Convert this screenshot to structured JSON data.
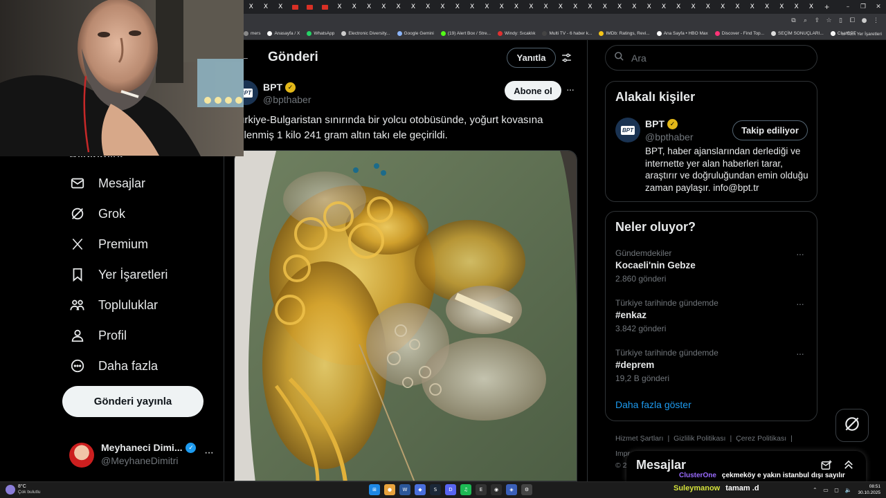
{
  "browser": {
    "tab_glyph": "X",
    "tab_plus": "+",
    "window_controls": [
      "–",
      "❐",
      "✕"
    ],
    "bookmarks": [
      {
        "label": "mers",
        "color": "#888888"
      },
      {
        "label": "Anasayfa / X",
        "color": "#ffffff"
      },
      {
        "label": "WhatsApp",
        "color": "#25d366"
      },
      {
        "label": "Electronic Diversity...",
        "color": "#cccccc"
      },
      {
        "label": "Google Gemini",
        "color": "#8ab4f8"
      },
      {
        "label": "(19) Alert Box / Stre...",
        "color": "#53fc18"
      },
      {
        "label": "Windy: Sıcaklık",
        "color": "#e03030"
      },
      {
        "label": "Multi TV - 6 haber k...",
        "color": "#444444"
      },
      {
        "label": "IMDb: Ratings, Revi...",
        "color": "#f5c518"
      },
      {
        "label": "Ana Sayfa • HBO Max",
        "color": "#ffffff"
      },
      {
        "label": "Discover - Find Top...",
        "color": "#ff3377"
      },
      {
        "label": "SEÇİM SONUÇLARI...",
        "color": "#dddddd"
      },
      {
        "label": "ChatGPT",
        "color": "#ffffff"
      }
    ],
    "bookmarks_overflow": "»",
    "all_bookmarks": "Tüm Yer İşaretleri"
  },
  "nav": {
    "partial_item": "Bildirimler",
    "items": [
      {
        "label": "Mesajlar",
        "icon": "envelope-icon"
      },
      {
        "label": "Grok",
        "icon": "grok-icon"
      },
      {
        "label": "Premium",
        "icon": "x-logo-icon"
      },
      {
        "label": "Yer İşaretleri",
        "icon": "bookmark-icon"
      },
      {
        "label": "Topluluklar",
        "icon": "communities-icon"
      },
      {
        "label": "Profil",
        "icon": "person-icon"
      },
      {
        "label": "Daha fazla",
        "icon": "more-circle-icon"
      }
    ],
    "post_button": "Gönderi yayınla"
  },
  "account": {
    "name": "Meyhaneci Dimi...",
    "handle": "@MeyhaneDimitri",
    "more": "···",
    "verified_color": "#1d9bf0"
  },
  "main": {
    "back": "←",
    "title": "Gönderi",
    "reply_button": "Yanıtla",
    "tweet": {
      "name": "BPT",
      "handle": "@bpthaber",
      "avatar_text": "BPT",
      "subscribe_button": "Abone ol",
      "more": "···",
      "text_line1": "ürkiye-Bulgaristan sınırında bir yolcu otobüsünde, yoğurt kovasına",
      "text_line2": "zlenmiş 1 kilo 241 gram altın takı ele geçirildi.",
      "photo": "gold-jewelry-photo"
    }
  },
  "right": {
    "search_placeholder": "Ara",
    "related": {
      "title": "Alakalı kişiler",
      "name": "BPT",
      "handle": "@bpthaber",
      "avatar_text": "BPT",
      "follow_button": "Takip ediliyor",
      "bio": "BPT, haber ajanslarından derlediği ve internette yer alan haberleri tarar, araştırır ve doğruluğundan emin olduğu zaman paylaşır. info@bpt.tr"
    },
    "trends": {
      "title": "Neler oluyor?",
      "more": "···",
      "items": [
        {
          "context": "Gündemdekiler",
          "name": "Kocaeli'nin Gebze",
          "count": "2.860 gönderi"
        },
        {
          "context": "Türkiye tarihinde gündemde",
          "name": "#enkaz",
          "count": "3.842 gönderi"
        },
        {
          "context": "Türkiye tarihinde gündemde",
          "name": "#deprem",
          "count": "19,2 B gönderi"
        }
      ],
      "show_more": "Daha fazla göster"
    },
    "footer": {
      "links": [
        "Hizmet Şartları",
        "Gizlilik Politikası",
        "Çerez Politikası"
      ],
      "separator": "|",
      "line2": "Impr",
      "line3": "© 2"
    },
    "brand_color": "#1d9bf0"
  },
  "messages_drawer": {
    "title": "Mesajlar"
  },
  "stream_chat": [
    {
      "user": "ClusterOne",
      "message": "çekmeköy e yakın istanbul dışı sayılır"
    },
    {
      "user": "Suleymanow",
      "message": "tamam .d"
    }
  ],
  "taskbar": {
    "weather_temp": "8°C",
    "weather_desc": "Çok bulutlu",
    "apps": [
      {
        "name": "windows-start-icon",
        "glyph": "⊞",
        "color": "#1e88e5"
      },
      {
        "name": "chrome-icon",
        "glyph": "●",
        "color": "#e8a33d"
      },
      {
        "name": "word-icon",
        "glyph": "W",
        "color": "#2b579a"
      },
      {
        "name": "app-icon-blue",
        "glyph": "◆",
        "color": "#4a6fdc"
      },
      {
        "name": "steam-icon",
        "glyph": "S",
        "color": "#1b2838"
      },
      {
        "name": "discord-icon",
        "glyph": "D",
        "color": "#5865f2"
      },
      {
        "name": "spotify-icon",
        "glyph": "♫",
        "color": "#1db954"
      },
      {
        "name": "epic-games-icon",
        "glyph": "E",
        "color": "#333333"
      },
      {
        "name": "obs-icon",
        "glyph": "◉",
        "color": "#2e2e2e"
      },
      {
        "name": "app-icon-blue-2",
        "glyph": "◈",
        "color": "#3a5fb8"
      },
      {
        "name": "app-icon-settings",
        "glyph": "⚙",
        "color": "#444444"
      }
    ],
    "tray": "⌃ ▭ ◻ 🔈",
    "time": "08:51",
    "date": "30.10.2025"
  }
}
